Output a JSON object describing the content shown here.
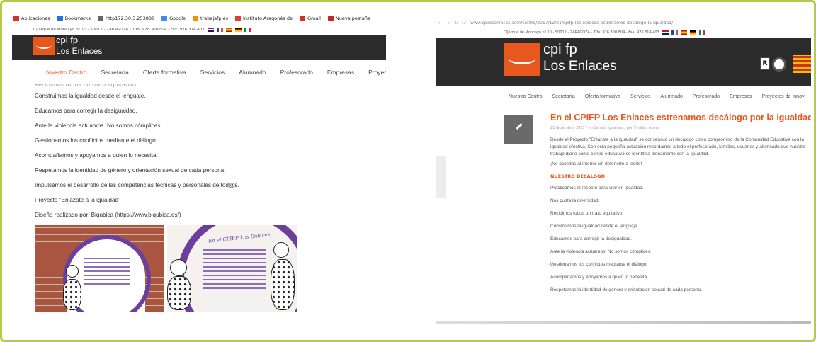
{
  "left": {
    "bookmarks": [
      {
        "label": "Aplicaciones",
        "icon": "apps-grid-icon",
        "color": "#d93025"
      },
      {
        "label": "Bookmarks",
        "icon": "star-icon",
        "color": "#1a73e8"
      },
      {
        "label": "http172.30.3.253888",
        "icon": "page-icon",
        "color": "#666666"
      },
      {
        "label": "Google",
        "icon": "google-icon",
        "color": "#4285f4"
      },
      {
        "label": "trabajafp.es",
        "icon": "site-icon",
        "color": "#f09300"
      },
      {
        "label": "Instituto Aragonés de",
        "icon": "site-icon",
        "color": "#e53935"
      },
      {
        "label": "Gmail",
        "icon": "gmail-icon",
        "color": "#d93025"
      },
      {
        "label": "Nueva pestaña",
        "icon": "site-icon",
        "color": "#c62828"
      }
    ],
    "address_line": "C/Jarque de Moncayo nº 10 - 50012 - ZARAGOZA - Tlfo: 976 300 804 - Fax: 976 314 403",
    "logo_title": "cpi fp",
    "logo_subtitle": "Los Enlaces",
    "nav": [
      "Nuestro Centro",
      "Secretaría",
      "Oferta formativa",
      "Servicios",
      "Alumnado",
      "Profesorado",
      "Empresas",
      "Proyectos"
    ],
    "cut_line": "Recibimos todos un trato equitativo.",
    "lines": [
      "Construimos la igualdad desde el lenguaje.",
      "Educamos para corregir  la desigualdad.",
      "Ante la violencia actuamos. No somos cómplices.",
      "Gestionamos los conflictos mediante el diálogo.",
      "Acompañamos y apoyamos a quien lo necesita.",
      "Respetamos la identidad de género y orientación sexual de cada persona.",
      "Impulsamos el desarrollo de las competencias técnicas y personales de tod@s.",
      "Proyecto \"Enlázate a la igualdad\"",
      "Diseño realizado por: Biqubica (https://www.biqubica.es/)"
    ],
    "poster_title": "En el CPIFP Los Enlaces"
  },
  "right": {
    "url_prefix": "www.cpilosenlaces.com",
    "url_rest": "/centro/2017/12/21/cpifp-los-enlaces-estrenamos-decalogo-la-igualdad/",
    "address_line": "C/Jarque de Moncayo nº 10 - 50012 - ZARAGOZA - Tlfo: 976 300 804 - Fax: 976 314 403",
    "logo_title": "cpi fp",
    "logo_subtitle": "Los Enlaces",
    "nav": [
      "Nuestro Centro",
      "Secretaría",
      "Oferta formativa",
      "Servicios",
      "Alumnado",
      "Profesorado",
      "Empresas",
      "Proyectos de Innov"
    ],
    "post_title": "En el CPIFP Los Enlaces estrenamos decálogo por la igualdad",
    "post_meta": "21 diciembre, 2017  /  en Centro, Igualdad  /  por Trinidad Abesa",
    "intro": "Desde el Proyecto \"Enlázate a la igualdad\" se consensuó un decálogo  como compromiso de la Comunidad Educativa con la igualdad efectiva. Con esta pequeña actuación recordamos a todo el profesorado, familias, usuarios y  alumnado  que  nuestro trabajo diario como centro educativo se identifica plenamente con la igualdad.",
    "invite": "¡No accedas al interior sin detenerte a leerlo!",
    "heading": "NUESTRO DECÁLOGO",
    "items": [
      "Practicamos el respeto para vivir en igualdad.",
      "Nos gusta la diversidad.",
      "Recibimos todos un trato equitativo.",
      "Construimos la igualdad desde el lenguaje.",
      "Educamos para corregir  la desigualdad.",
      "Ante la violencia actuamos. No somos cómplices.",
      "Gestionamos los conflictos mediante el diálogo.",
      "Acompañamos y apoyamos a quien lo necesita.",
      "Respetamos la identidad de género y orientación sexual de cada persona."
    ]
  },
  "colors": {
    "accent": "#e8571e",
    "header_bg": "#2b2b2b",
    "frame_border": "#b6c94a"
  }
}
